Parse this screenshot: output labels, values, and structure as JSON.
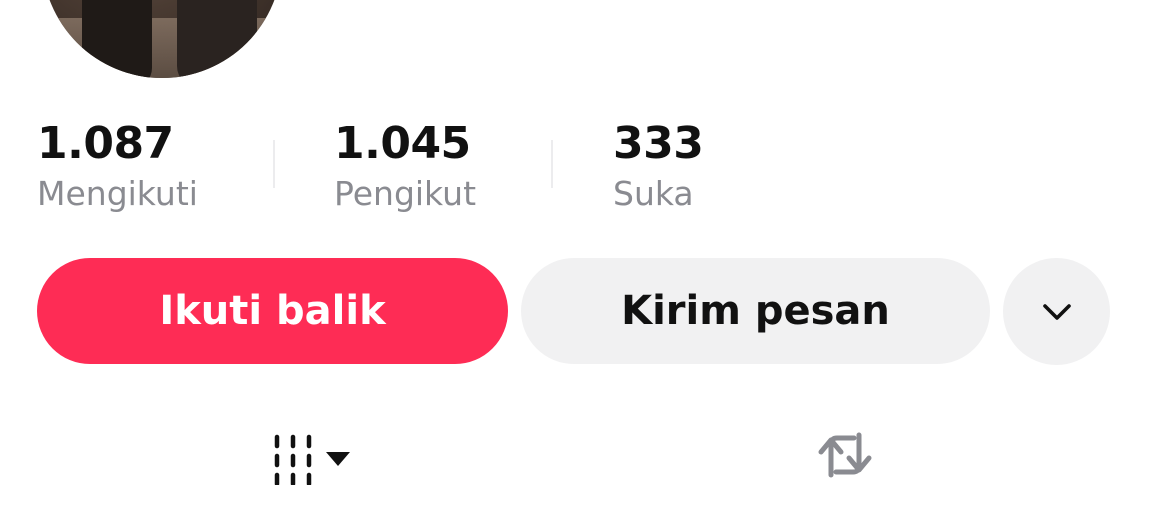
{
  "profile": {
    "stats": [
      {
        "value": "1.087",
        "label": "Mengikuti"
      },
      {
        "value": "1.045",
        "label": "Pengikut"
      },
      {
        "value": "333",
        "label": "Suka"
      }
    ]
  },
  "actions": {
    "follow_back_label": "Ikuti balik",
    "message_label": "Kirim pesan",
    "more_icon": "chevron-down-icon"
  },
  "tabs": [
    {
      "icon": "grid-icon",
      "has_dropdown": true,
      "selected": true
    },
    {
      "icon": "repost-icon",
      "selected": false
    }
  ],
  "colors": {
    "accent": "#fe2c55",
    "secondary_button_bg": "#f1f1f2",
    "label_gray": "#8a8b91",
    "text": "#111111"
  }
}
